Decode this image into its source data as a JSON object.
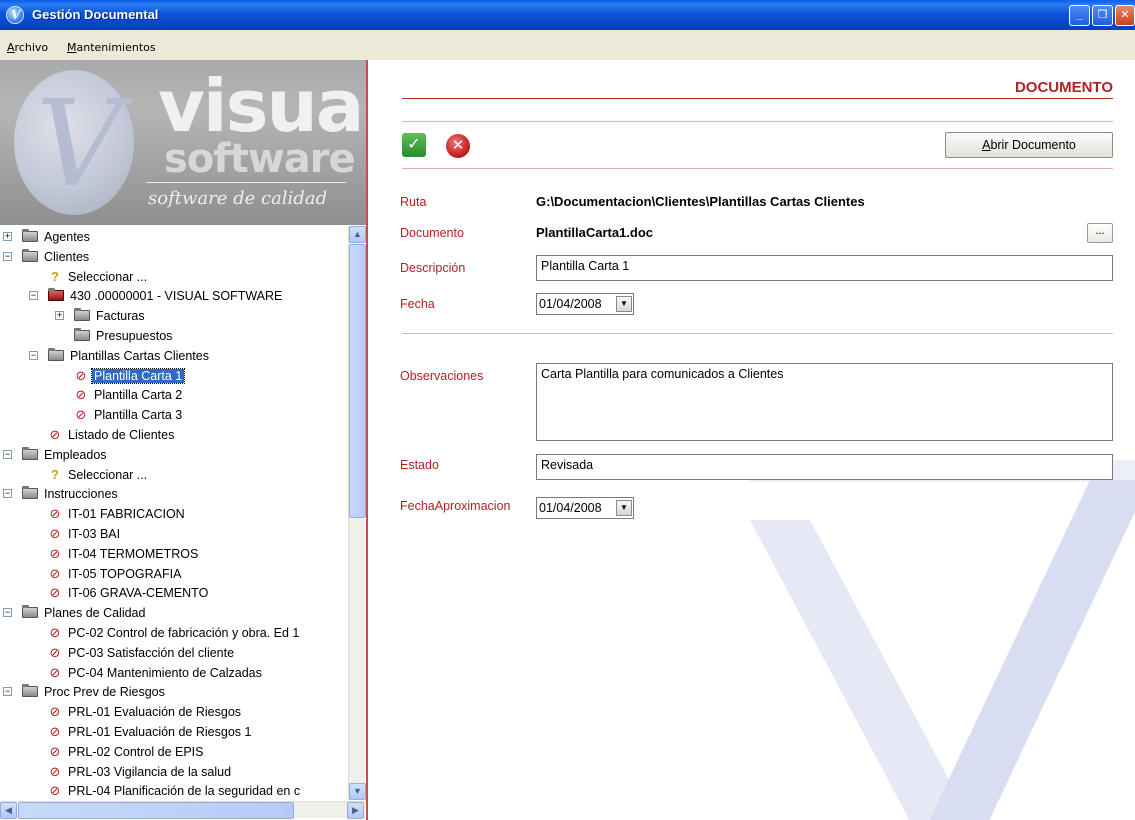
{
  "window": {
    "title": "Gestión Documental"
  },
  "menu": [
    {
      "label": "Archivo",
      "accel": "A"
    },
    {
      "label": "Mantenimientos",
      "accel": "M"
    }
  ],
  "logo": {
    "brand": "visual",
    "brand2": "software",
    "tagline": "software de calidad"
  },
  "tree": [
    {
      "label": "Agentes",
      "depth": 0,
      "icon": "folder-icon",
      "expander": "+"
    },
    {
      "label": "Clientes",
      "depth": 0,
      "icon": "folder-icon",
      "expander": "-"
    },
    {
      "label": "Seleccionar ...",
      "depth": 1,
      "icon": "key-icon"
    },
    {
      "label": "430 .00000001 - VISUAL SOFTWARE",
      "depth": 1,
      "icon": "red-folder-icon",
      "expander": "-"
    },
    {
      "label": "Facturas",
      "depth": 2,
      "icon": "folder-icon",
      "expander": "+"
    },
    {
      "label": "Presupuestos",
      "depth": 2,
      "icon": "folder-icon"
    },
    {
      "label": "Plantillas Cartas Clientes",
      "depth": 1,
      "icon": "folder-icon",
      "expander": "-"
    },
    {
      "label": "Plantilla Carta 1",
      "depth": 2,
      "icon": "document-icon",
      "selected": true
    },
    {
      "label": "Plantilla Carta 2",
      "depth": 2,
      "icon": "document-icon"
    },
    {
      "label": "Plantilla Carta 3",
      "depth": 2,
      "icon": "document-icon"
    },
    {
      "label": "Listado de Clientes",
      "depth": 1,
      "icon": "document-icon"
    },
    {
      "label": "Empleados",
      "depth": 0,
      "icon": "folder-icon",
      "expander": "-"
    },
    {
      "label": "Seleccionar ...",
      "depth": 1,
      "icon": "key-icon"
    },
    {
      "label": "Instrucciones",
      "depth": 0,
      "icon": "folder-icon",
      "expander": "-"
    },
    {
      "label": "IT-01 FABRICACION",
      "depth": 1,
      "icon": "document-icon"
    },
    {
      "label": "IT-03 BAI",
      "depth": 1,
      "icon": "document-icon"
    },
    {
      "label": "IT-04 TERMOMETROS",
      "depth": 1,
      "icon": "document-icon"
    },
    {
      "label": "IT-05 TOPOGRAFIA",
      "depth": 1,
      "icon": "document-icon"
    },
    {
      "label": "IT-06 GRAVA-CEMENTO",
      "depth": 1,
      "icon": "document-icon"
    },
    {
      "label": "Planes de Calidad",
      "depth": 0,
      "icon": "folder-icon",
      "expander": "-"
    },
    {
      "label": "PC-02 Control de fabricación y obra. Ed 1",
      "depth": 1,
      "icon": "document-icon"
    },
    {
      "label": "PC-03 Satisfacción del cliente",
      "depth": 1,
      "icon": "document-icon"
    },
    {
      "label": "PC-04 Mantenimiento de Calzadas",
      "depth": 1,
      "icon": "document-icon"
    },
    {
      "label": "Proc Prev de Riesgos",
      "depth": 0,
      "icon": "folder-icon",
      "expander": "-"
    },
    {
      "label": "PRL-01 Evaluación de Riesgos",
      "depth": 1,
      "icon": "document-icon"
    },
    {
      "label": "PRL-01 Evaluación de Riesgos 1",
      "depth": 1,
      "icon": "document-icon"
    },
    {
      "label": "PRL-02 Control de EPIS",
      "depth": 1,
      "icon": "document-icon"
    },
    {
      "label": "PRL-03 Vigilancia de la salud",
      "depth": 1,
      "icon": "document-icon"
    },
    {
      "label": "PRL-04 Planificación de la seguridad en c",
      "depth": 1,
      "icon": "document-icon"
    }
  ],
  "form": {
    "header": "DOCUMENTO",
    "open_button": "Abrir Documento",
    "open_button_accel": "A",
    "dots_button": "...",
    "ruta_label": "Ruta",
    "ruta_value": "G:\\Documentacion\\Clientes\\Plantillas Cartas Clientes",
    "documento_label": "Documento",
    "documento_value": "PlantillaCarta1.doc",
    "descripcion_label": "Descripción",
    "descripcion_value": "Plantilla Carta 1",
    "fecha_label": "Fecha",
    "fecha_value": "01/04/2008",
    "observaciones_label": "Observaciones",
    "observaciones_value": "Carta Plantilla para comunicados a Clientes",
    "estado_label": "Estado",
    "estado_value": "Revisada",
    "fecha_aprox_label": "FechaAproximacion",
    "fecha_aprox_value": "01/04/2008"
  },
  "colors": {
    "accent": "#b22222",
    "selection": "#316ac5",
    "titlebar": "#0a4fd0"
  }
}
